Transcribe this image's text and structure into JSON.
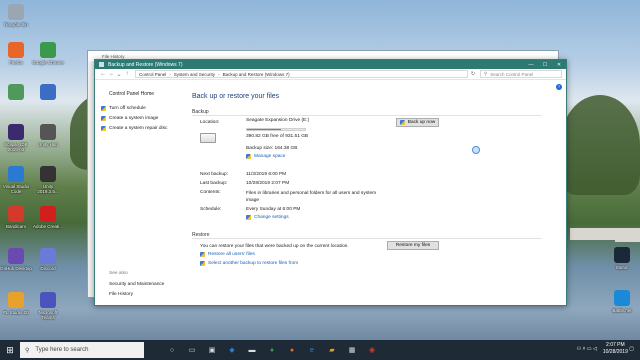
{
  "desktop": {
    "icons_left": [
      {
        "label": "Recycle Bin",
        "color": "#9aa6b2"
      },
      {
        "label": "Firefox",
        "color": "#e8662a"
      },
      {
        "label": "Google Chrome",
        "color": "#3a9a4a"
      },
      {
        "label": "",
        "color": "#4f9a5a"
      },
      {
        "label": "",
        "color": "#3b6dc4"
      },
      {
        "label": "Eclipse IDE 2019-03",
        "color": "#3a2a70"
      },
      {
        "label": "Unity Hub",
        "color": "#555555"
      },
      {
        "label": "Visual Studio Code",
        "color": "#2a7ad4"
      },
      {
        "label": "Unity 2019.2.5...",
        "color": "#333333"
      },
      {
        "label": "Bandicam",
        "color": "#d33a2a"
      },
      {
        "label": "Adobe Creati...",
        "color": "#d21e1e"
      },
      {
        "label": "GitHub Desktop",
        "color": "#6a4ab0"
      },
      {
        "label": "Discord",
        "color": "#6a7ad8"
      },
      {
        "label": "FL Studio 20",
        "color": "#e8a12a"
      },
      {
        "label": "Microsoft Teams",
        "color": "#4b53bc"
      }
    ],
    "icons_right": [
      {
        "label": "Steam",
        "color": "#1b2838"
      },
      {
        "label": "Battle.net",
        "color": "#1a8ad8"
      }
    ]
  },
  "back_window": {
    "title": "File History"
  },
  "window": {
    "title": "Backup and Restore (Windows 7)",
    "controls": [
      "—",
      "☐",
      "✕"
    ],
    "breadcrumbs": [
      "Control Panel",
      "System and Security",
      "Backup and Restore (Windows 7)"
    ],
    "search_placeholder": "Search Control Panel"
  },
  "sidebar": {
    "home": "Control Panel Home",
    "links": [
      "Turn off schedule",
      "Create a system image",
      "Create a system repair disc"
    ],
    "see_also_label": "See also",
    "see_also": [
      "Security and Maintenance",
      "File History"
    ]
  },
  "main": {
    "heading": "Back up or restore your files",
    "backup_section": "Backup",
    "location_label": "Location:",
    "location_value": "Seagate Expansion Drive (E:)",
    "free_space": "390.82 GB free of 931.51 GB",
    "disk_used_fraction": 0.58,
    "backup_size": "Backup size: 164.38 GB",
    "manage_space": "Manage space",
    "back_up_now": "Back up now",
    "next_backup_label": "Next backup:",
    "next_backup": "11/3/2019 6:00 PM",
    "last_backup_label": "Last backup:",
    "last_backup": "10/28/2019 2:07 PM",
    "contents_label": "Contents:",
    "contents": "Files in libraries and personal folders for all users and system image",
    "schedule_label": "Schedule:",
    "schedule": "Every Sunday at 6:00 PM",
    "change_settings": "Change settings",
    "restore_section": "Restore",
    "restore_text": "You can restore your files that were backed up on the current location.",
    "restore_my_files": "Restore my files",
    "restore_all_users": "Restore all users' files",
    "select_another": "Select another backup to restore files from"
  },
  "taskbar": {
    "search_placeholder": "Type here to search",
    "time": "2:07 PM",
    "date": "10/28/2019"
  }
}
